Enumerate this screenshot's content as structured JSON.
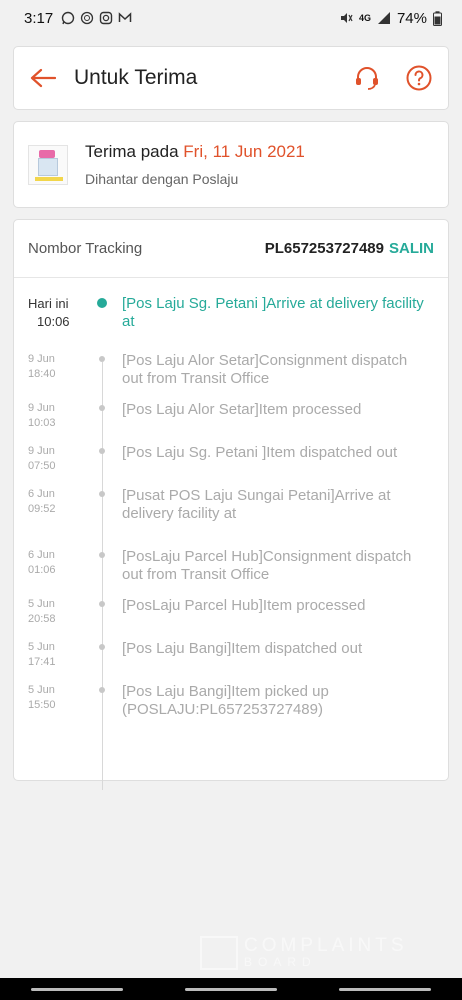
{
  "status_bar": {
    "time": "3:17",
    "battery": "74%",
    "network": "4G"
  },
  "header": {
    "title": "Untuk Terima",
    "accent": "#e0522b"
  },
  "receive": {
    "label": "Terima pada",
    "date": "Fri, 11 Jun 2021",
    "courier_line": "Dihantar dengan Poslaju"
  },
  "tracking": {
    "label": "Nombor Tracking",
    "number": "PL657253727489",
    "copy_label": "SALIN",
    "events": [
      {
        "date": "Hari ini",
        "time": "10:06",
        "text": "[Pos Laju Sg. Petani ]Arrive at delivery facility at",
        "active": true
      },
      {
        "date": "9 Jun",
        "time": "18:40",
        "text": "[Pos Laju Alor Setar]Consignment dispatch out from Transit Office"
      },
      {
        "date": "9 Jun",
        "time": "10:03",
        "text": "[Pos Laju Alor Setar]Item processed"
      },
      {
        "date": "9 Jun",
        "time": "07:50",
        "text": "[Pos Laju Sg. Petani ]Item dispatched out"
      },
      {
        "date": "6 Jun",
        "time": "09:52",
        "text": "[Pusat POS Laju Sungai Petani]Arrive at delivery facility at"
      },
      {
        "date": "6 Jun",
        "time": "01:06",
        "text": "[PosLaju Parcel Hub]Consignment dispatch out from Transit Office"
      },
      {
        "date": "5 Jun",
        "time": "20:58",
        "text": "[PosLaju Parcel Hub]Item processed"
      },
      {
        "date": "5 Jun",
        "time": "17:41",
        "text": "[Pos Laju Bangi]Item dispatched out"
      },
      {
        "date": "5 Jun",
        "time": "15:50",
        "text": "[Pos Laju Bangi]Item picked up (POSLAJU:PL657253727489)"
      }
    ],
    "active_color": "#26aa99"
  },
  "watermark": {
    "text": "COMPLAINTS",
    "sub": "BOARD"
  }
}
